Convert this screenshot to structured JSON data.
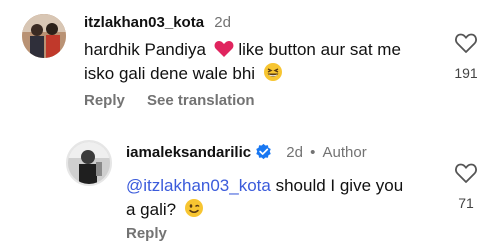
{
  "comment1": {
    "username": "itzlakhan03_kota",
    "time": "2d",
    "text_part1": "hardhik Pandiya",
    "text_part2": " like button  aur sat me",
    "text_line2": "isko gali dene wale bhi",
    "heart_emoji": "heart-emoji",
    "grin_emoji": "grinning-squinting-emoji",
    "like_count": "191",
    "reply_label": "Reply",
    "translate_label": "See translation"
  },
  "reply1": {
    "username": "iamaleksandarilic",
    "time": "2d",
    "separator": "•",
    "author_badge": "Author",
    "mention": "@itzlakhan03_kota",
    "text_line1": " should I give you",
    "text_line2": "a gali?",
    "wink_emoji": "winking-emoji",
    "like_count": "71",
    "reply_label": "Reply"
  },
  "colors": {
    "mention": "#3b5bdb",
    "verified": "#1877f2",
    "meta": "#737373"
  }
}
